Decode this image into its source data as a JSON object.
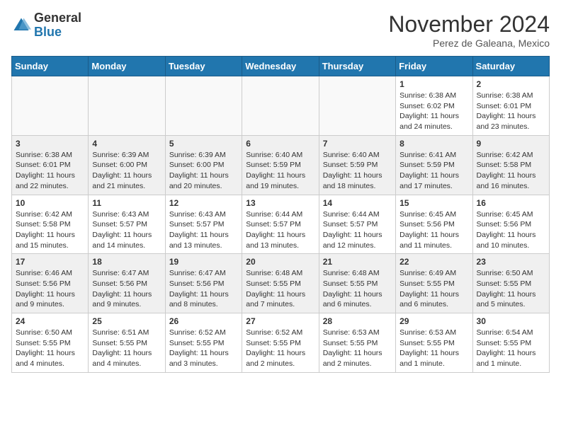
{
  "logo": {
    "general": "General",
    "blue": "Blue"
  },
  "title": "November 2024",
  "location": "Perez de Galeana, Mexico",
  "days_of_week": [
    "Sunday",
    "Monday",
    "Tuesday",
    "Wednesday",
    "Thursday",
    "Friday",
    "Saturday"
  ],
  "weeks": [
    [
      {
        "day": "",
        "empty": true
      },
      {
        "day": "",
        "empty": true
      },
      {
        "day": "",
        "empty": true
      },
      {
        "day": "",
        "empty": true
      },
      {
        "day": "",
        "empty": true
      },
      {
        "day": "1",
        "sunrise": "6:38 AM",
        "sunset": "6:02 PM",
        "daylight": "11 hours and 24 minutes."
      },
      {
        "day": "2",
        "sunrise": "6:38 AM",
        "sunset": "6:01 PM",
        "daylight": "11 hours and 23 minutes."
      }
    ],
    [
      {
        "day": "3",
        "sunrise": "6:38 AM",
        "sunset": "6:01 PM",
        "daylight": "11 hours and 22 minutes."
      },
      {
        "day": "4",
        "sunrise": "6:39 AM",
        "sunset": "6:00 PM",
        "daylight": "11 hours and 21 minutes."
      },
      {
        "day": "5",
        "sunrise": "6:39 AM",
        "sunset": "6:00 PM",
        "daylight": "11 hours and 20 minutes."
      },
      {
        "day": "6",
        "sunrise": "6:40 AM",
        "sunset": "5:59 PM",
        "daylight": "11 hours and 19 minutes."
      },
      {
        "day": "7",
        "sunrise": "6:40 AM",
        "sunset": "5:59 PM",
        "daylight": "11 hours and 18 minutes."
      },
      {
        "day": "8",
        "sunrise": "6:41 AM",
        "sunset": "5:59 PM",
        "daylight": "11 hours and 17 minutes."
      },
      {
        "day": "9",
        "sunrise": "6:42 AM",
        "sunset": "5:58 PM",
        "daylight": "11 hours and 16 minutes."
      }
    ],
    [
      {
        "day": "10",
        "sunrise": "6:42 AM",
        "sunset": "5:58 PM",
        "daylight": "11 hours and 15 minutes."
      },
      {
        "day": "11",
        "sunrise": "6:43 AM",
        "sunset": "5:57 PM",
        "daylight": "11 hours and 14 minutes."
      },
      {
        "day": "12",
        "sunrise": "6:43 AM",
        "sunset": "5:57 PM",
        "daylight": "11 hours and 13 minutes."
      },
      {
        "day": "13",
        "sunrise": "6:44 AM",
        "sunset": "5:57 PM",
        "daylight": "11 hours and 13 minutes."
      },
      {
        "day": "14",
        "sunrise": "6:44 AM",
        "sunset": "5:57 PM",
        "daylight": "11 hours and 12 minutes."
      },
      {
        "day": "15",
        "sunrise": "6:45 AM",
        "sunset": "5:56 PM",
        "daylight": "11 hours and 11 minutes."
      },
      {
        "day": "16",
        "sunrise": "6:45 AM",
        "sunset": "5:56 PM",
        "daylight": "11 hours and 10 minutes."
      }
    ],
    [
      {
        "day": "17",
        "sunrise": "6:46 AM",
        "sunset": "5:56 PM",
        "daylight": "11 hours and 9 minutes."
      },
      {
        "day": "18",
        "sunrise": "6:47 AM",
        "sunset": "5:56 PM",
        "daylight": "11 hours and 9 minutes."
      },
      {
        "day": "19",
        "sunrise": "6:47 AM",
        "sunset": "5:56 PM",
        "daylight": "11 hours and 8 minutes."
      },
      {
        "day": "20",
        "sunrise": "6:48 AM",
        "sunset": "5:55 PM",
        "daylight": "11 hours and 7 minutes."
      },
      {
        "day": "21",
        "sunrise": "6:48 AM",
        "sunset": "5:55 PM",
        "daylight": "11 hours and 6 minutes."
      },
      {
        "day": "22",
        "sunrise": "6:49 AM",
        "sunset": "5:55 PM",
        "daylight": "11 hours and 6 minutes."
      },
      {
        "day": "23",
        "sunrise": "6:50 AM",
        "sunset": "5:55 PM",
        "daylight": "11 hours and 5 minutes."
      }
    ],
    [
      {
        "day": "24",
        "sunrise": "6:50 AM",
        "sunset": "5:55 PM",
        "daylight": "11 hours and 4 minutes."
      },
      {
        "day": "25",
        "sunrise": "6:51 AM",
        "sunset": "5:55 PM",
        "daylight": "11 hours and 4 minutes."
      },
      {
        "day": "26",
        "sunrise": "6:52 AM",
        "sunset": "5:55 PM",
        "daylight": "11 hours and 3 minutes."
      },
      {
        "day": "27",
        "sunrise": "6:52 AM",
        "sunset": "5:55 PM",
        "daylight": "11 hours and 2 minutes."
      },
      {
        "day": "28",
        "sunrise": "6:53 AM",
        "sunset": "5:55 PM",
        "daylight": "11 hours and 2 minutes."
      },
      {
        "day": "29",
        "sunrise": "6:53 AM",
        "sunset": "5:55 PM",
        "daylight": "11 hours and 1 minute."
      },
      {
        "day": "30",
        "sunrise": "6:54 AM",
        "sunset": "5:55 PM",
        "daylight": "11 hours and 1 minute."
      }
    ]
  ],
  "labels": {
    "sunrise": "Sunrise:",
    "sunset": "Sunset:",
    "daylight": "Daylight hours"
  }
}
